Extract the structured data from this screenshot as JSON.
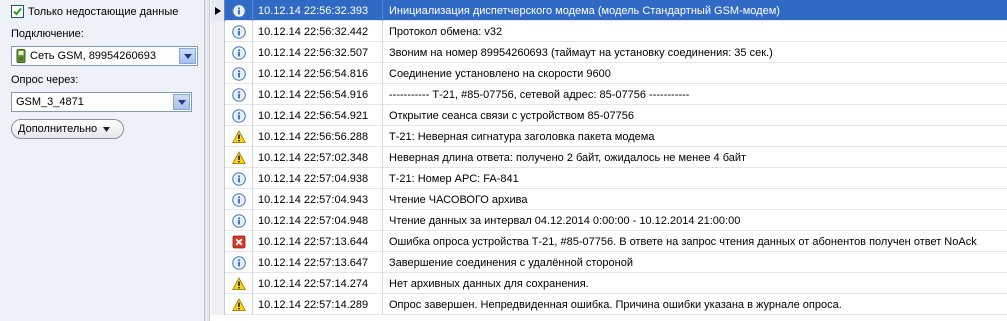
{
  "left_panel": {
    "only_missing_label": "Только недостающие данные",
    "only_missing_checked": true,
    "connection_label": "Подключение:",
    "connection_value": "Сеть GSM, 89954260693",
    "poll_via_label": "Опрос через:",
    "poll_via_value": "GSM_3_4871",
    "more_button_label": "Дополнительно"
  },
  "log": {
    "selected_index": 0,
    "rows": [
      {
        "icon": "info-icon",
        "time": "10.12.14 22:56:32.393",
        "message": "Инициализация диспетчерского модема (модель Стандартный GSM-модем)"
      },
      {
        "icon": "info-icon",
        "time": "10.12.14 22:56:32.442",
        "message": "Протокол обмена: v32"
      },
      {
        "icon": "info-icon",
        "time": "10.12.14 22:56:32.507",
        "message": "Звоним на номер 89954260693 (таймаут на установку соединения: 35 сек.)"
      },
      {
        "icon": "info-icon",
        "time": "10.12.14 22:56:54.816",
        "message": "Соединение установлено на скорости 9600"
      },
      {
        "icon": "info-icon",
        "time": "10.12.14 22:56:54.916",
        "message": "----------- Т-21, #85-07756, сетевой адрес: 85-07756 -----------"
      },
      {
        "icon": "info-icon",
        "time": "10.12.14 22:56:54.921",
        "message": "Открытие сеанса связи с устройством 85-07756"
      },
      {
        "icon": "warning-icon",
        "time": "10.12.14 22:56:56.288",
        "message": "Т-21: Неверная сигнатура заголовка пакета модема"
      },
      {
        "icon": "warning-icon",
        "time": "10.12.14 22:57:02.348",
        "message": "Неверная длина ответа: получено 2 байт, ожидалось не менее 4 байт"
      },
      {
        "icon": "info-icon",
        "time": "10.12.14 22:57:04.938",
        "message": "Т-21: Номер АРС: FA-841"
      },
      {
        "icon": "info-icon",
        "time": "10.12.14 22:57:04.943",
        "message": "Чтение ЧАСОВОГО архива"
      },
      {
        "icon": "info-icon",
        "time": "10.12.14 22:57:04.948",
        "message": "Чтение данных за интервал 04.12.2014 0:00:00 - 10.12.2014 21:00:00"
      },
      {
        "icon": "error-icon",
        "time": "10.12.14 22:57:13.644",
        "message": "Ошибка опроса устройства Т-21, #85-07756. В ответе на запрос чтения данных от абонентов получен ответ NoAck"
      },
      {
        "icon": "info-icon",
        "time": "10.12.14 22:57:13.647",
        "message": "Завершение соединения с удалённой стороной"
      },
      {
        "icon": "warning-icon",
        "time": "10.12.14 22:57:14.274",
        "message": "Нет архивных данных для сохранения."
      },
      {
        "icon": "warning-icon",
        "time": "10.12.14 22:57:14.289",
        "message": "Опрос завершен. Непредвиденная ошибка. Причина ошибки указана в журнале опроса."
      }
    ]
  }
}
